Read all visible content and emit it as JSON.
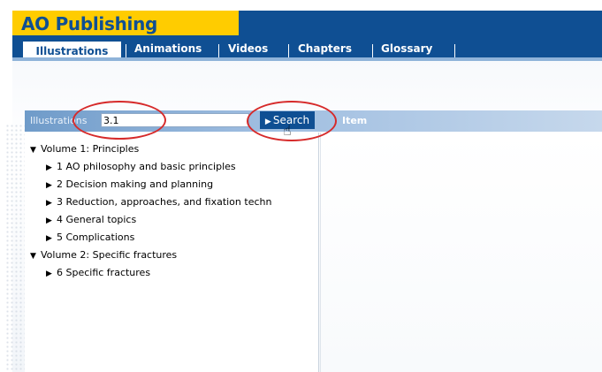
{
  "header": {
    "logo_prefix": "AO",
    "logo_word": "Publishing"
  },
  "nav": {
    "tabs": [
      {
        "label": "Illustrations",
        "active": true
      },
      {
        "label": "Animations"
      },
      {
        "label": "Videos"
      },
      {
        "label": "Chapters"
      },
      {
        "label": "Glossary"
      }
    ]
  },
  "search": {
    "label": "Illustrations",
    "value": "3.1",
    "button_label": "Search",
    "item_label": "Item"
  },
  "tree": {
    "volumes": [
      {
        "label": "Volume 1: Principles",
        "children": [
          "1 AO philosophy and basic principles",
          "2 Decision making and planning",
          "3 Reduction, approaches, and fixation techn",
          "4 General topics",
          "5 Complications"
        ]
      },
      {
        "label": "Volume 2: Specific fractures",
        "children": [
          "6 Specific fractures"
        ]
      }
    ]
  },
  "colors": {
    "brand_blue": "#0f4f93",
    "brand_yellow": "#ffcc00",
    "annotation_red": "#d62a2a"
  },
  "icons": {
    "expanded": "caret-down-icon",
    "collapsed": "caret-right-icon",
    "cursor": "hand-pointer-icon"
  }
}
